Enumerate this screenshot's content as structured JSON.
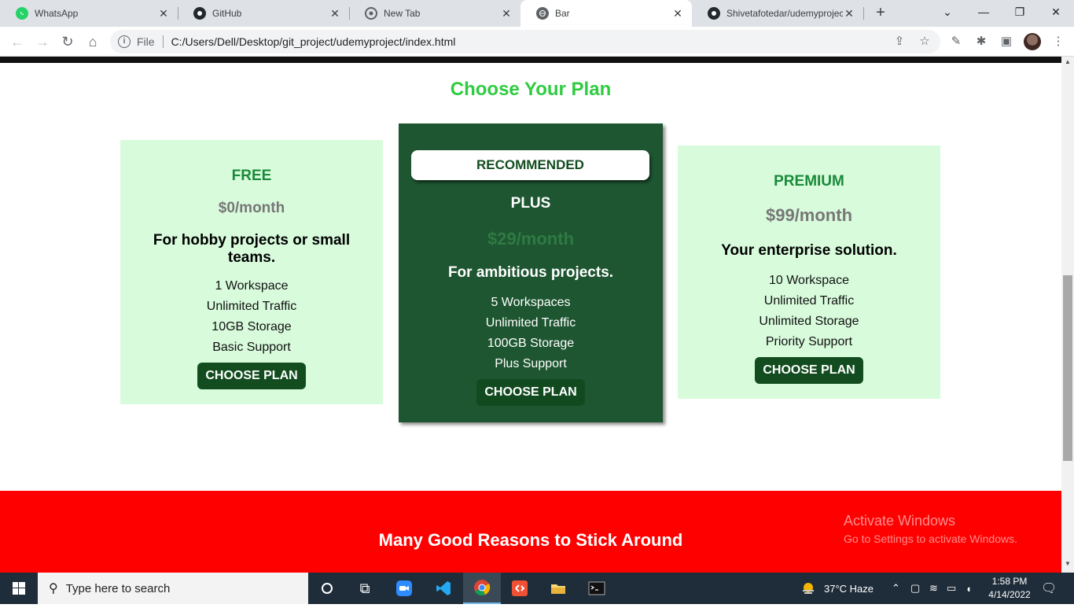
{
  "browser": {
    "tabs": [
      {
        "label": "WhatsApp",
        "icon": "whatsapp-icon",
        "active": false
      },
      {
        "label": "GitHub",
        "icon": "github-icon",
        "active": false
      },
      {
        "label": "New Tab",
        "icon": "chrome-icon",
        "active": false
      },
      {
        "label": "Bar",
        "icon": "globe-icon",
        "active": true
      },
      {
        "label": "Shivetafotedar/udemyproject",
        "icon": "github-icon",
        "active": false
      }
    ],
    "new_tab_symbol": "+",
    "address": {
      "scheme_label": "File",
      "url": "C:/Users/Dell/Desktop/git_project/udemyproject/index.html"
    }
  },
  "page": {
    "section_title": "Choose Your Plan",
    "recommended_badge": "RECOMMENDED",
    "plans": [
      {
        "name": "FREE",
        "price": "$0/month",
        "description": "For hobby projects or small teams.",
        "features": [
          "1 Workspace",
          "Unlimited Traffic",
          "10GB Storage",
          "Basic Support"
        ],
        "button": "CHOOSE PLAN"
      },
      {
        "name": "PLUS",
        "price": "$29/month",
        "description": "For ambitious projects.",
        "features": [
          "5 Workspaces",
          "Unlimited Traffic",
          "100GB Storage",
          "Plus Support"
        ],
        "button": "CHOOSE PLAN"
      },
      {
        "name": "PREMIUM",
        "price": "$99/month",
        "description": "Your enterprise solution.",
        "features": [
          "10 Workspace",
          "Unlimited Traffic",
          "Unlimited Storage",
          "Priority Support"
        ],
        "button": "CHOOSE PLAN"
      }
    ],
    "reasons_title": "Many Good Reasons to Stick Around",
    "watermark": {
      "line1": "Activate Windows",
      "line2": "Go to Settings to activate Windows."
    }
  },
  "taskbar": {
    "search_placeholder": "Type here to search",
    "weather": "37°C  Haze",
    "time": "1:58 PM",
    "date": "4/14/2022"
  },
  "colors": {
    "title_green": "#2ecc40",
    "card_light": "#d8fbdc",
    "card_dark": "#1e5631",
    "button_green": "#134d1f",
    "reasons_red": "#ff0000"
  }
}
